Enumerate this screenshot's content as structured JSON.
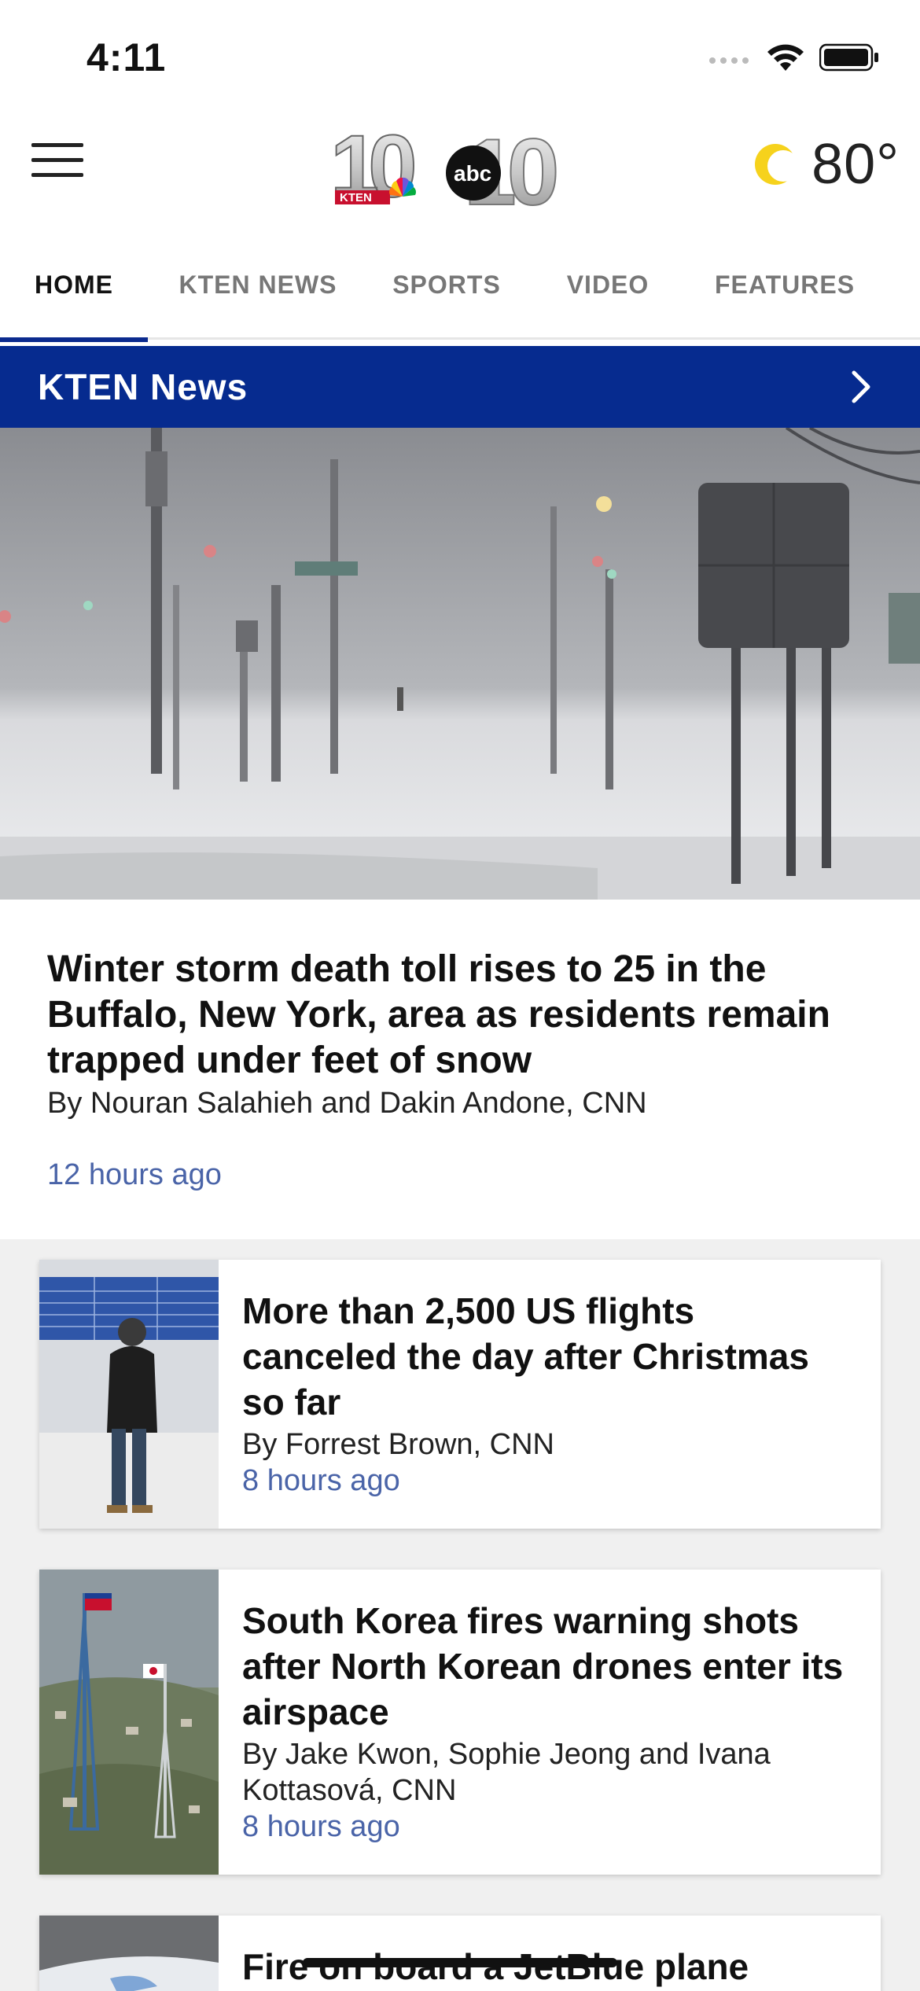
{
  "status": {
    "time": "4:11"
  },
  "header": {
    "logo_text_left": "10",
    "logo_text_right": "10",
    "logo_badge_kten": "KTEN",
    "logo_badge_abc": "abc",
    "weather_temp": "80°",
    "weather_icon": "partly-cloudy-icon"
  },
  "tabs": [
    {
      "label": "HOME",
      "active": true
    },
    {
      "label": "KTEN NEWS",
      "active": false
    },
    {
      "label": "SPORTS",
      "active": false
    },
    {
      "label": "VIDEO",
      "active": false
    },
    {
      "label": "FEATURES",
      "active": false
    }
  ],
  "section": {
    "title": "KTEN News"
  },
  "hero": {
    "headline": "Winter storm death toll rises to 25 in the Buffalo, New York, area as residents remain trapped under feet of snow",
    "byline": "By Nouran Salahieh and Dakin Andone, CNN",
    "time": "12 hours ago"
  },
  "articles": [
    {
      "headline": "More than 2,500 US flights canceled the day after Christmas so far",
      "byline": "By Forrest Brown, CNN",
      "time": "8 hours ago"
    },
    {
      "headline": "South Korea fires warning shots after North Korean drones enter its airspace",
      "byline": "By Jake Kwon, Sophie Jeong and Ivana Kottasová, CNN",
      "time": "8 hours ago"
    },
    {
      "headline": "Fire on board a JetBlue plane",
      "byline": "",
      "time": ""
    }
  ],
  "colors": {
    "brand_blue": "#062b8f",
    "timestamp": "#4a64a8"
  }
}
